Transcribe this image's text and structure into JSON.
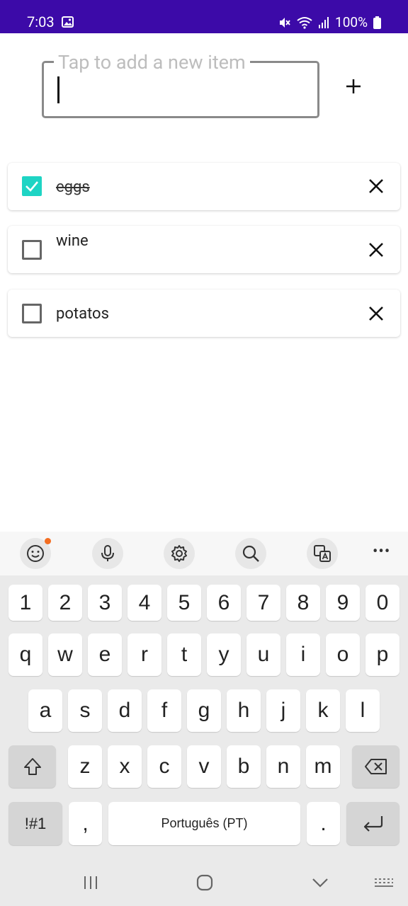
{
  "status_bar": {
    "time": "7:03",
    "battery": "100%"
  },
  "input": {
    "placeholder": "Tap to add a new item"
  },
  "items": [
    {
      "label": "eggs",
      "checked": true
    },
    {
      "label": "wine",
      "checked": false
    },
    {
      "label": "potatos",
      "checked": false
    }
  ],
  "keyboard": {
    "numbers": [
      "1",
      "2",
      "3",
      "4",
      "5",
      "6",
      "7",
      "8",
      "9",
      "0"
    ],
    "row1": [
      "q",
      "w",
      "e",
      "r",
      "t",
      "y",
      "u",
      "i",
      "o",
      "p"
    ],
    "row2": [
      "a",
      "s",
      "d",
      "f",
      "g",
      "h",
      "j",
      "k",
      "l"
    ],
    "row3": [
      "z",
      "x",
      "c",
      "v",
      "b",
      "n",
      "m"
    ],
    "symbols_label": "!#1",
    "comma": ",",
    "space_label": "Português (PT)",
    "period": "."
  },
  "colors": {
    "status_bar": "#3c0aa8",
    "checkbox_checked": "#1ed4c4",
    "notification_dot": "#f36d21"
  }
}
